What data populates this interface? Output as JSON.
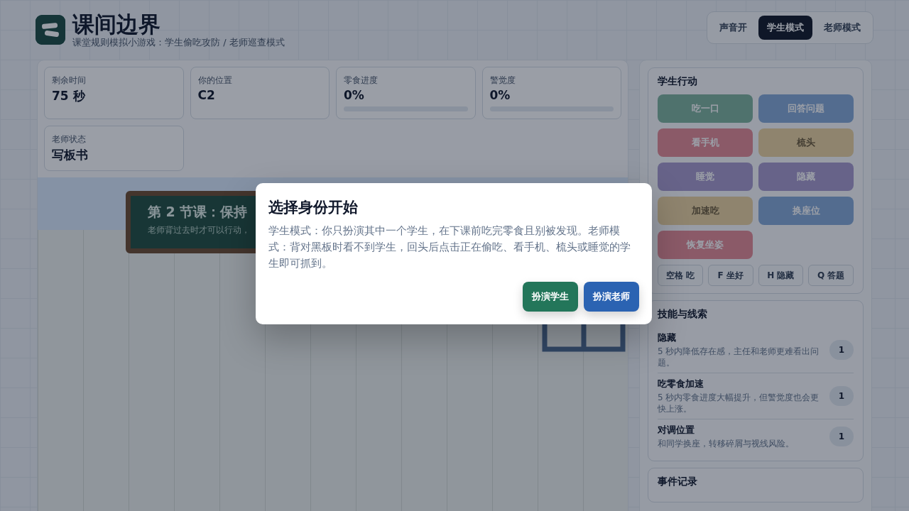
{
  "header": {
    "title": "课间边界",
    "subtitle": "课堂规则模拟小游戏：学生偷吃攻防 / 老师巡查模式"
  },
  "modes": [
    {
      "label": "声音开",
      "selected": false
    },
    {
      "label": "学生模式",
      "selected": true
    },
    {
      "label": "老师模式",
      "selected": false
    }
  ],
  "stats": [
    {
      "label": "剩余时间",
      "value": "75 秒"
    },
    {
      "label": "你的位置",
      "value": "C2"
    },
    {
      "label": "零食进度",
      "value": "0%",
      "level": 0
    },
    {
      "label": "警觉度",
      "value": "0%",
      "level": 0
    },
    {
      "label": "老师状态",
      "value": "写板书"
    }
  ],
  "blackboard": {
    "title": "第 2 节课：保持",
    "subtitle": "老师背过去时才可以行动，"
  },
  "actions": {
    "title": "学生行动",
    "buttons": [
      {
        "label": "吃一口",
        "kind": "primary"
      },
      {
        "label": "回答问题",
        "kind": "info"
      },
      {
        "label": "看手机",
        "kind": "danger"
      },
      {
        "label": "梳头",
        "kind": "warning"
      },
      {
        "label": "睡觉",
        "kind": "muted"
      },
      {
        "label": "隐藏",
        "kind": "muted"
      },
      {
        "label": "加速吃",
        "kind": "warning"
      },
      {
        "label": "换座位",
        "kind": "info"
      },
      {
        "label": "恢复坐姿",
        "kind": "danger"
      }
    ],
    "keys": [
      "空格 吃",
      "F 坐好",
      "H 隐藏",
      "Q 答题"
    ]
  },
  "skills": {
    "title": "技能与线索",
    "items": [
      {
        "name": "隐藏",
        "desc": "5 秒内降低存在感，主任和老师更难看出问题。",
        "count": "1"
      },
      {
        "name": "吃零食加速",
        "desc": "5 秒内零食进度大幅提升，但警觉度也会更快上涨。",
        "count": "1"
      },
      {
        "name": "对调位置",
        "desc": "和同学换座，转移碎屑与视线风险。",
        "count": "1"
      }
    ]
  },
  "log": {
    "title": "事件记录"
  },
  "dialog": {
    "title": "选择身份开始",
    "text": "学生模式：你只扮演其中一个学生，在下课前吃完零食且别被发现。老师模式：背对黑板时看不到学生，回头后点击正在偷吃、看手机、梳头或睡觉的学生即可抓到。",
    "buttons": [
      {
        "label": "扮演学生",
        "kind": "student"
      },
      {
        "label": "扮演老师",
        "kind": "teacher"
      }
    ]
  }
}
